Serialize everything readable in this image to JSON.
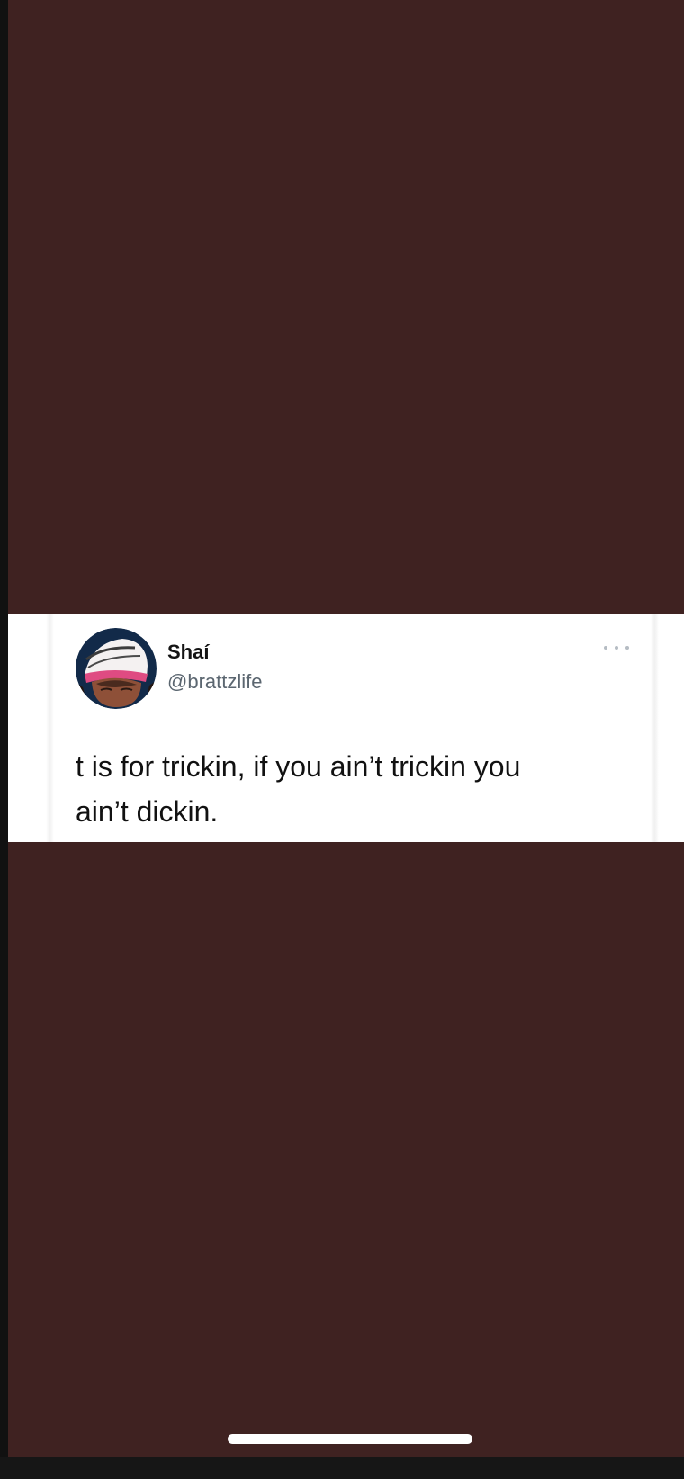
{
  "post": {
    "display_name": "Shaí",
    "handle": "@brattzlife",
    "text": "t is for trickin, if you ain’t trickin you\nain’t dickin."
  },
  "icons": {
    "more": "more-options-icon",
    "avatar": "profile-avatar"
  },
  "colors": {
    "background": "#3f2221",
    "card": "#ffffff",
    "name_text": "#141414",
    "handle_text": "#5b6670",
    "body_text": "#111111"
  }
}
